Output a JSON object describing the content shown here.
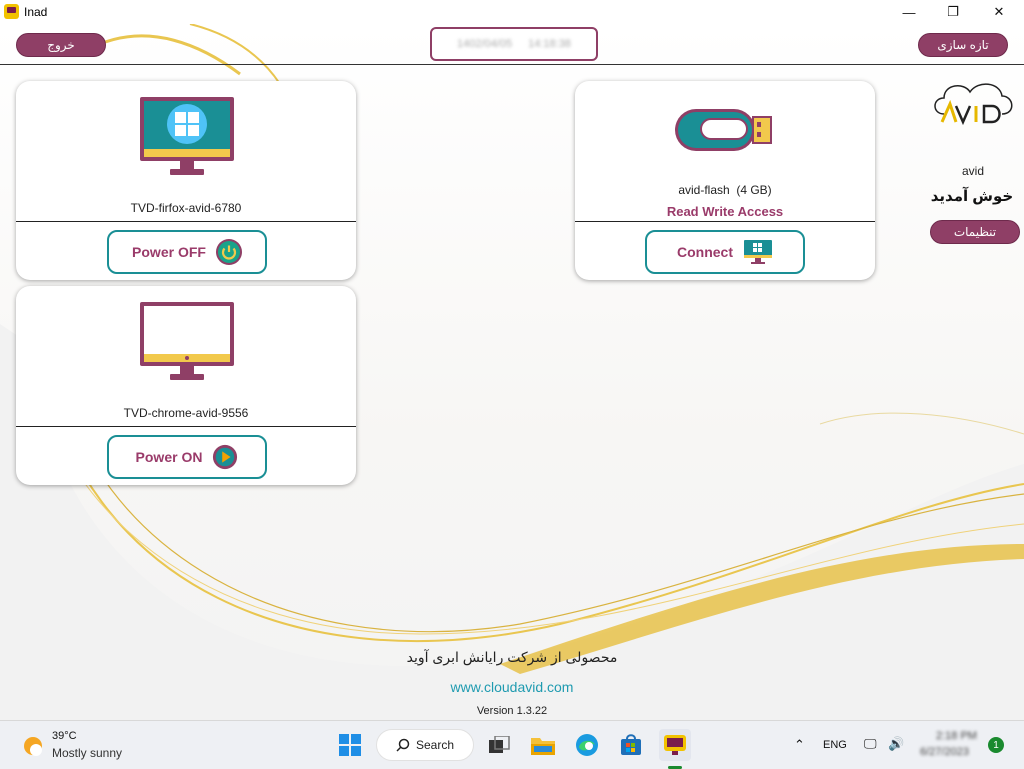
{
  "window": {
    "title": "Inad",
    "minimize_icon": "—",
    "maximize_icon": "❐",
    "close_icon": "✕"
  },
  "header": {
    "exit_label": "خروج",
    "refresh_label": "تازه سازی",
    "date_text": "1402/04/05",
    "time_text": "14:18:38"
  },
  "devices": [
    {
      "name": "TVD-firfox-avid-6780",
      "os": "windows",
      "button_label": "Power OFF",
      "button_icon": "power-icon"
    },
    {
      "name": "TVD-chrome-avid-9556",
      "os": "none",
      "button_label": "Power ON",
      "button_icon": "play-icon"
    }
  ],
  "flash": {
    "name": "avid-flash",
    "size": "(4 GB)",
    "access": "Read Write Access",
    "button_label": "Connect"
  },
  "profile": {
    "brand": "AVID",
    "username": "avid",
    "welcome": "خوش آمدید",
    "settings_label": "تنظیمات"
  },
  "footer": {
    "company": "محصولی از شرکت رایانش ابری آوید",
    "website": "www.cloudavid.com",
    "version": "Version 1.3.22"
  },
  "taskbar": {
    "weather_temp": "39°C",
    "weather_desc": "Mostly sunny",
    "search_label": "Search",
    "lang": "ENG",
    "clock_time": "2:18 PM",
    "clock_date": "6/27/2023",
    "notifications": "1"
  },
  "colors": {
    "accent": "#8f3f66",
    "teal": "#1a8f95",
    "gold": "#e6b800"
  }
}
